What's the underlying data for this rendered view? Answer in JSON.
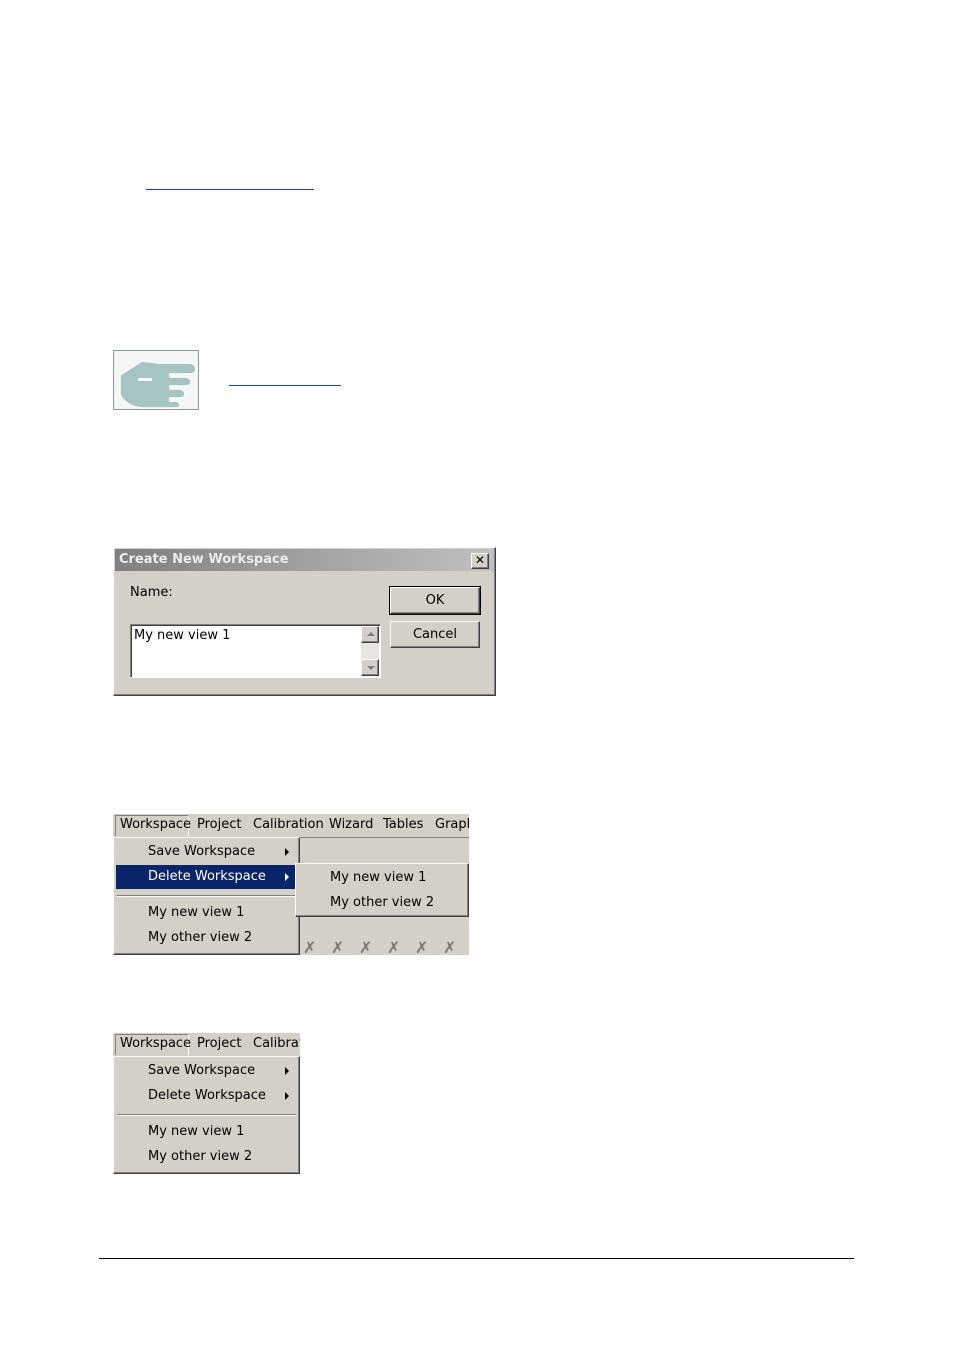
{
  "dialog": {
    "title": "Create New Workspace",
    "close_glyph": "✕",
    "name_label": "Name:",
    "name_value": "My new view 1",
    "ok_label": "OK",
    "cancel_label": "Cancel"
  },
  "menubar_full": {
    "items": [
      "Workspace",
      "Project",
      "Calibration",
      "Wizard",
      "Tables",
      "Graph"
    ]
  },
  "menubar_short": {
    "items": [
      "Workspace",
      "Project",
      "Calibrati"
    ]
  },
  "workspace_menu": {
    "save_workspace": "Save Workspace",
    "delete_workspace": "Delete Workspace",
    "view_1": "My new view 1",
    "view_2": "My other view 2"
  },
  "delete_submenu": {
    "items": [
      "My new view 1",
      "My other view 2"
    ]
  },
  "colors": {
    "highlight": "#0a246a",
    "link": "#1a3ec8",
    "window_face": "#d4d0c8"
  }
}
